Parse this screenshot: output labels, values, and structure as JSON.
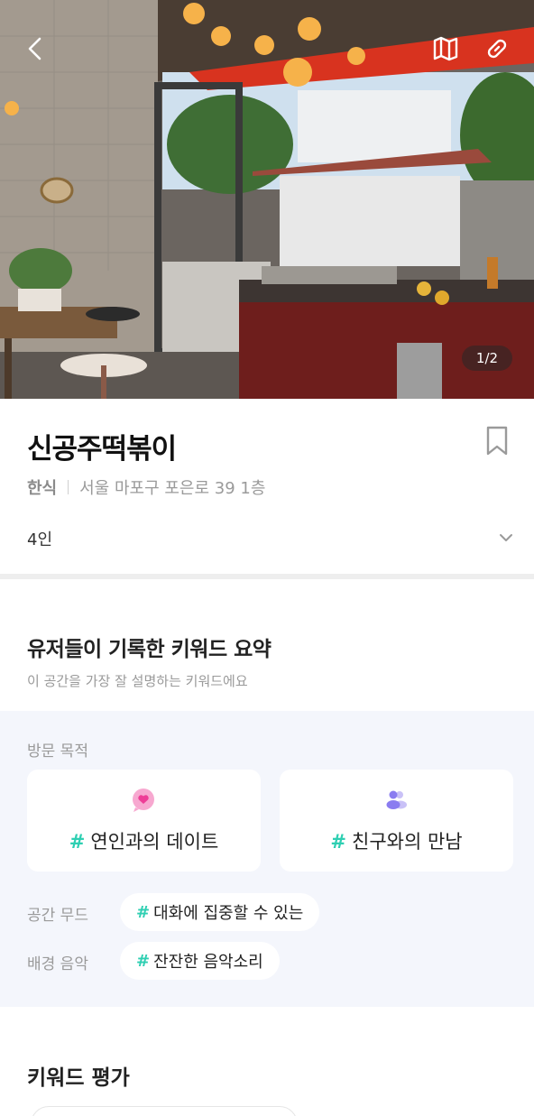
{
  "header": {
    "back_icon": "chevron-left-icon",
    "map_icon": "map-icon",
    "link_icon": "link-icon",
    "photo_counter": "1/2"
  },
  "place": {
    "name": "신공주떡볶이",
    "category": "한식",
    "address": "서울 마포구 포은로 39 1층",
    "party_size": "4인"
  },
  "keyword_summary": {
    "title": "유저들이 기록한 키워드 요약",
    "subtitle": "이 공간을 가장 잘 설명하는 키워드에요",
    "visit_purpose_label": "방문 목적",
    "purposes": [
      {
        "icon": "heart-bubble-icon",
        "hash": "#",
        "text": "연인과의 데이트"
      },
      {
        "icon": "people-icon",
        "hash": "#",
        "text": "친구와의 만남"
      }
    ],
    "mood_label": "공간 무드",
    "mood": {
      "hash": "#",
      "text": "대화에 집중할 수 있는"
    },
    "music_label": "배경 음악",
    "music": {
      "hash": "#",
      "text": "잔잔한 음악소리"
    }
  },
  "keyword_rating": {
    "title": "키워드 평가"
  },
  "colors": {
    "accent_hash": "#2ecfb2",
    "heart_pink": "#f06ab0",
    "people_purple": "#9b8ef0",
    "panel_bg": "#f4f6fc"
  }
}
